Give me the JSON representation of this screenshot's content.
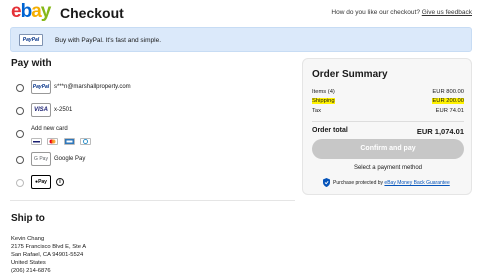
{
  "header": {
    "logo": {
      "e": "e",
      "b": "b",
      "a": "a",
      "y": "y"
    },
    "title": "Checkout",
    "feedback_question": "How do you like our checkout?",
    "feedback_link": "Give us feedback"
  },
  "paypal_banner": {
    "logo_text": "PayPal",
    "text": "Buy with PayPal. It's fast and simple."
  },
  "pay_with": {
    "heading": "Pay with",
    "options": [
      {
        "logo": "PayPal",
        "label": "s***n@marshallproperty.com"
      },
      {
        "logo": "VISA",
        "label": "x-2501"
      },
      {
        "label": "Add new card"
      },
      {
        "logo": "G Pay",
        "label": "Google Pay"
      },
      {
        "logo": "Pay",
        "label": "",
        "info_icon": "info-icon"
      }
    ]
  },
  "ship_to": {
    "heading": "Ship to",
    "address": [
      "Kevin Chang",
      "2175 Francisco Blvd E, Ste A",
      "San Rafael, CA 94901-5524",
      "United States",
      "(206) 214-6876"
    ]
  },
  "order_summary": {
    "title": "Order Summary",
    "rows": [
      {
        "label": "Items (4)",
        "value": "EUR 800.00"
      },
      {
        "label": "Shipping",
        "value": "EUR 200.00"
      },
      {
        "label": "Tax",
        "value": "EUR 74.01"
      }
    ],
    "total_label": "Order total",
    "total_value": "EUR 1,074.01",
    "confirm_label": "Confirm and pay",
    "select_note": "Select a payment method",
    "protect_prefix": "Purchase protected by ",
    "protect_link": "eBay Money Back Guarantee"
  },
  "colors": {
    "ebay_red": "#e53238",
    "ebay_blue": "#0064d2",
    "ebay_yellow": "#f5af02",
    "ebay_green": "#86b817",
    "banner_bg": "#dbe9fa",
    "highlight": "#fff200",
    "disabled_button": "#c7c7c7"
  }
}
